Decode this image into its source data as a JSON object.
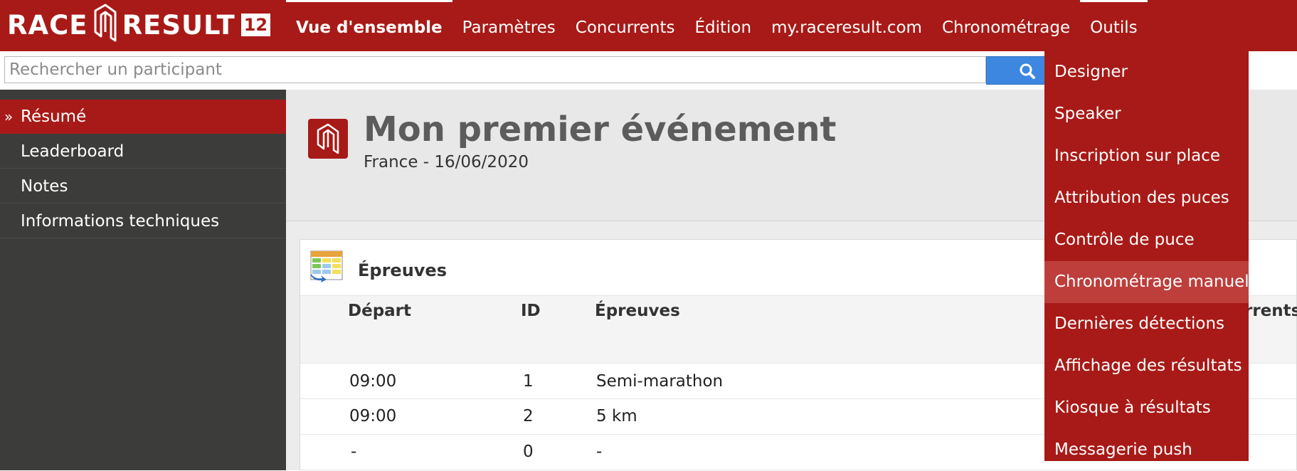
{
  "logo": {
    "text_left": "RACE",
    "text_right": "RESULT",
    "version": "12"
  },
  "nav": {
    "items": [
      {
        "label": "Vue d'ensemble"
      },
      {
        "label": "Paramètres"
      },
      {
        "label": "Concurrents"
      },
      {
        "label": "Édition"
      },
      {
        "label": "my.raceresult.com"
      },
      {
        "label": "Chronométrage"
      },
      {
        "label": "Outils"
      }
    ],
    "active": "Vue d'ensemble",
    "open_menu": "Outils"
  },
  "search": {
    "placeholder": "Rechercher un participant",
    "value": "",
    "icon": "search-icon"
  },
  "sidebar": {
    "items": [
      {
        "label": "Résumé",
        "active": true,
        "marker": "»"
      },
      {
        "label": "Leaderboard"
      },
      {
        "label": "Notes"
      },
      {
        "label": "Informations techniques"
      }
    ]
  },
  "event": {
    "title": "Mon premier événement",
    "subtitle": "France - 16/06/2020",
    "icon": "event-logo-icon"
  },
  "contests": {
    "title": "Épreuves",
    "icon": "table-icon",
    "columns": [
      "Départ",
      "ID",
      "Épreuves",
      "rrents"
    ],
    "rows": [
      {
        "start": "09:00",
        "id": "1",
        "name": "Semi-marathon"
      },
      {
        "start": "09:00",
        "id": "2",
        "name": "5 km"
      },
      {
        "start": "-",
        "id": "0",
        "name": "-"
      }
    ]
  },
  "tools_menu": {
    "items": [
      {
        "label": "Designer"
      },
      {
        "label": "Speaker"
      },
      {
        "label": "Inscription sur place"
      },
      {
        "label": "Attribution des puces"
      },
      {
        "label": "Contrôle de puce"
      },
      {
        "label": "Chronométrage manuel",
        "hover": true
      },
      {
        "label": "Dernières détections"
      },
      {
        "label": "Affichage des résultats"
      },
      {
        "label": "Kiosque à résultats"
      },
      {
        "label": "Messagerie push"
      }
    ]
  },
  "colors": {
    "brand_red": "#a81a17",
    "sidebar_dark": "#3c3d3b",
    "search_blue": "#3d87e0",
    "menu_hover": "#bd3e3b"
  }
}
